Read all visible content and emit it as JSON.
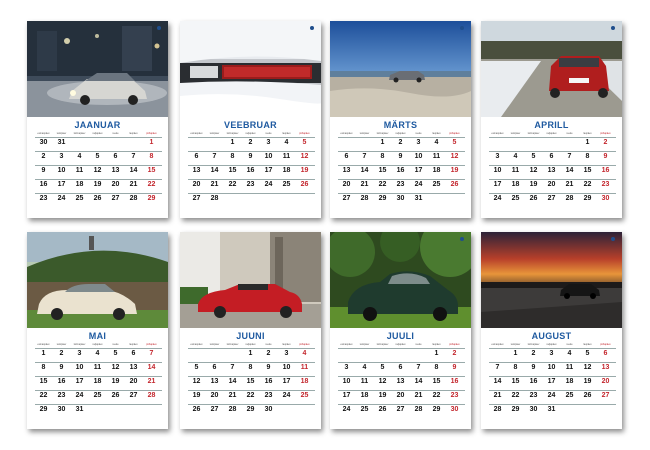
{
  "colors": {
    "accent": "#1f5aa0",
    "sunday": "#c3262d",
    "text": "#111111"
  },
  "logo_icon": "saab-logo-icon",
  "weekday_labels": [
    "esmaspäev",
    "teisipäev",
    "kolmapäev",
    "neljapäev",
    "reede",
    "laupäev",
    "pühapäev"
  ],
  "pages": [
    {
      "month": "JAANUAR",
      "rows": [
        [
          "30",
          "31",
          "",
          "",
          "",
          "",
          "1"
        ],
        [
          "2",
          "3",
          "4",
          "5",
          "6",
          "7",
          "8"
        ],
        [
          "9",
          "10",
          "11",
          "12",
          "13",
          "14",
          "15"
        ],
        [
          "16",
          "17",
          "18",
          "19",
          "20",
          "21",
          "22"
        ],
        [
          "23",
          "24",
          "25",
          "26",
          "27",
          "28",
          "29"
        ]
      ]
    },
    {
      "month": "VEEBRUAR",
      "rows": [
        [
          "",
          "",
          "1",
          "2",
          "3",
          "4",
          "5"
        ],
        [
          "6",
          "7",
          "8",
          "9",
          "10",
          "11",
          "12"
        ],
        [
          "13",
          "14",
          "15",
          "16",
          "17",
          "18",
          "19"
        ],
        [
          "20",
          "21",
          "22",
          "23",
          "24",
          "25",
          "26"
        ],
        [
          "27",
          "28",
          "",
          "",
          "",
          "",
          ""
        ]
      ]
    },
    {
      "month": "MÄRTS",
      "rows": [
        [
          "",
          "",
          "1",
          "2",
          "3",
          "4",
          "5"
        ],
        [
          "6",
          "7",
          "8",
          "9",
          "10",
          "11",
          "12"
        ],
        [
          "13",
          "14",
          "15",
          "16",
          "17",
          "18",
          "19"
        ],
        [
          "20",
          "21",
          "22",
          "23",
          "24",
          "25",
          "26"
        ],
        [
          "27",
          "28",
          "29",
          "30",
          "31",
          "",
          ""
        ]
      ]
    },
    {
      "month": "APRILL",
      "rows": [
        [
          "",
          "",
          "",
          "",
          "",
          "1",
          "2"
        ],
        [
          "3",
          "4",
          "5",
          "6",
          "7",
          "8",
          "9"
        ],
        [
          "10",
          "11",
          "12",
          "13",
          "14",
          "15",
          "16"
        ],
        [
          "17",
          "18",
          "19",
          "20",
          "21",
          "22",
          "23"
        ],
        [
          "24",
          "25",
          "26",
          "27",
          "28",
          "29",
          "30"
        ]
      ]
    },
    {
      "month": "MAI",
      "rows": [
        [
          "1",
          "2",
          "3",
          "4",
          "5",
          "6",
          "7"
        ],
        [
          "8",
          "9",
          "10",
          "11",
          "12",
          "13",
          "14"
        ],
        [
          "15",
          "16",
          "17",
          "18",
          "19",
          "20",
          "21"
        ],
        [
          "22",
          "23",
          "24",
          "25",
          "26",
          "27",
          "28"
        ],
        [
          "29",
          "30",
          "31",
          "",
          "",
          "",
          ""
        ]
      ]
    },
    {
      "month": "JUUNI",
      "rows": [
        [
          "",
          "",
          "",
          "1",
          "2",
          "3",
          "4"
        ],
        [
          "5",
          "6",
          "7",
          "8",
          "9",
          "10",
          "11"
        ],
        [
          "12",
          "13",
          "14",
          "15",
          "16",
          "17",
          "18"
        ],
        [
          "19",
          "20",
          "21",
          "22",
          "23",
          "24",
          "25"
        ],
        [
          "26",
          "27",
          "28",
          "29",
          "30",
          "",
          ""
        ]
      ]
    },
    {
      "month": "JUULI",
      "rows": [
        [
          "",
          "",
          "",
          "",
          "",
          "1",
          "2"
        ],
        [
          "3",
          "4",
          "5",
          "6",
          "7",
          "8",
          "9"
        ],
        [
          "10",
          "11",
          "12",
          "13",
          "14",
          "15",
          "16"
        ],
        [
          "17",
          "18",
          "19",
          "20",
          "21",
          "22",
          "23"
        ],
        [
          "24",
          "25",
          "26",
          "27",
          "28",
          "29",
          "30"
        ]
      ],
      "extra_row": [
        "31",
        "",
        "",
        "",
        "",
        "",
        ""
      ]
    },
    {
      "month": "AUGUST",
      "rows": [
        [
          "",
          "1",
          "2",
          "3",
          "4",
          "5",
          "6"
        ],
        [
          "7",
          "8",
          "9",
          "10",
          "11",
          "12",
          "13"
        ],
        [
          "14",
          "15",
          "16",
          "17",
          "18",
          "19",
          "20"
        ],
        [
          "21",
          "22",
          "23",
          "24",
          "25",
          "26",
          "27"
        ],
        [
          "28",
          "29",
          "30",
          "31",
          "",
          "",
          ""
        ]
      ]
    }
  ]
}
